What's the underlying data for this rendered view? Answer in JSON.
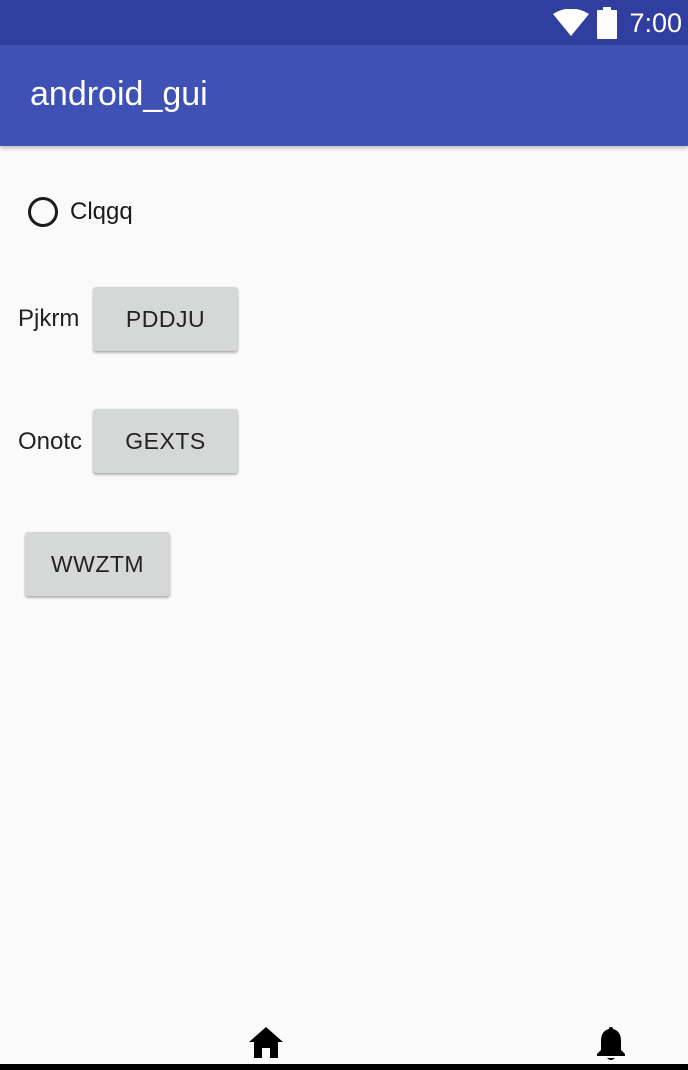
{
  "status_bar": {
    "time": "7:00",
    "icons": [
      "wifi-icon",
      "battery-icon"
    ],
    "color": "#303f9f"
  },
  "app_bar": {
    "title": "android_gui",
    "color": "#3f51b5"
  },
  "radio": {
    "label": "Clqgq",
    "checked": false
  },
  "rows": [
    {
      "label": "Pjkrm",
      "button": "PDDJU"
    },
    {
      "label": "Onotc",
      "button": "GEXTS"
    }
  ],
  "standalone_button": "WWZTM",
  "bottom_nav": {
    "icons": [
      "home-icon",
      "bell-icon"
    ]
  }
}
